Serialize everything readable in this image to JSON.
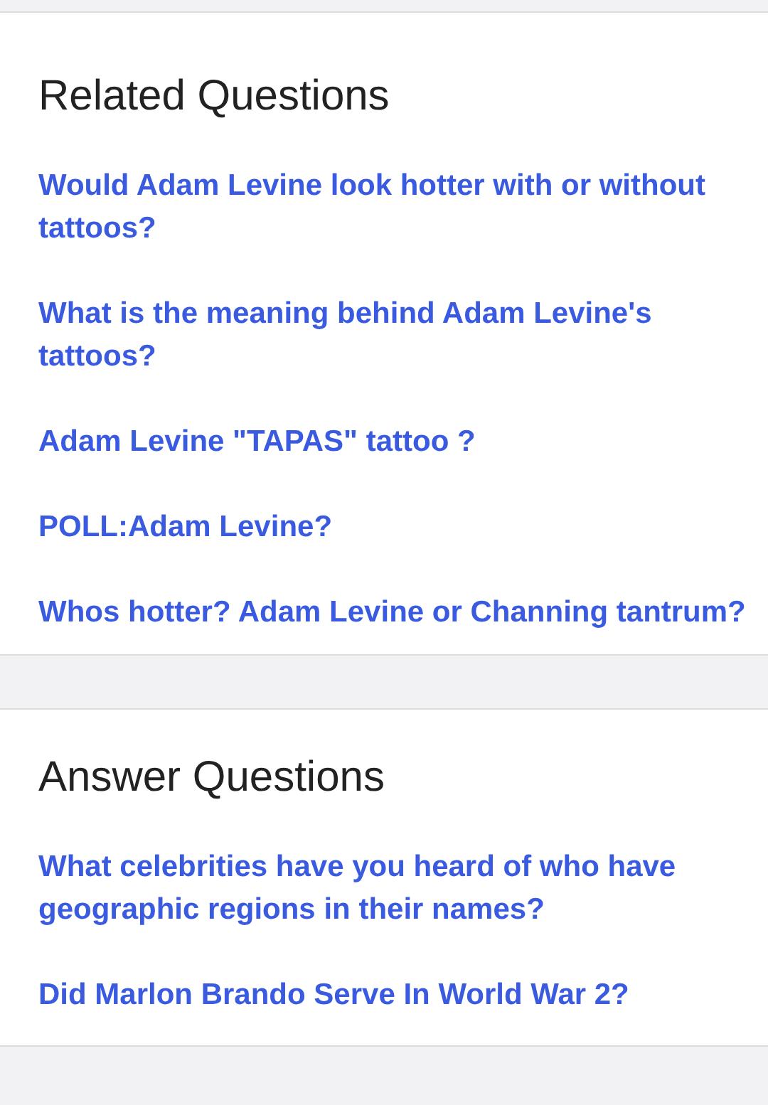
{
  "sections": [
    {
      "title": "Related Questions",
      "links": [
        "Would Adam Levine look hotter with or without tattoos?",
        "What is the meaning behind Adam Levine's tattoos?",
        "Adam Levine \"TAPAS\" tattoo ?",
        "POLL:Adam Levine?",
        "Whos hotter? Adam Levine or Channing tantrum?"
      ]
    },
    {
      "title": "Answer Questions",
      "links": [
        "What celebrities have you heard of who have geographic regions in their names?",
        "Did Marlon Brando Serve In World War 2?"
      ]
    }
  ]
}
